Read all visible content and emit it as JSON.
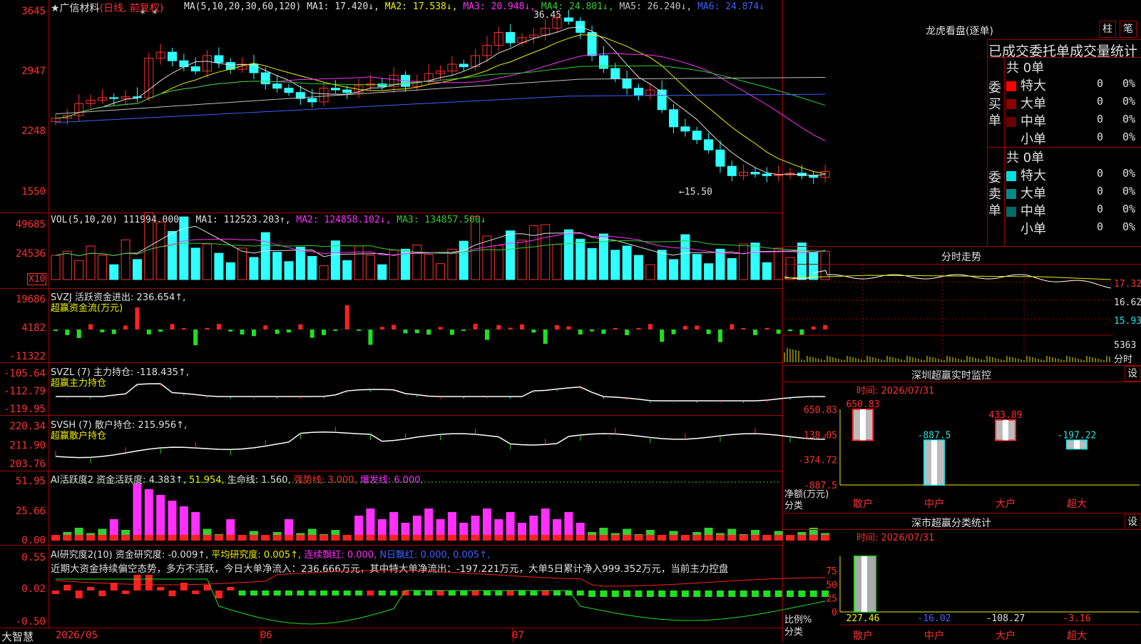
{
  "main": {
    "title": "★广信材料",
    "period": "(日线, 前复权)",
    "ma_prefix": "MA(5,10,20,30,60,120)",
    "ma": [
      {
        "label": "MA1: 17.420↓,",
        "color": "#e0e0e0"
      },
      {
        "label": "MA2: 17.538↓,",
        "color": "#f0f000"
      },
      {
        "label": "MA3: 20.948↓,",
        "color": "#ff30ff"
      },
      {
        "label": "MA4: 24.801↓,",
        "color": "#30d030"
      },
      {
        "label": "MA5: 26.240↓,",
        "color": "#c0c0c0"
      },
      {
        "label": "MA6: 24.874↓",
        "color": "#4060ff"
      }
    ],
    "y_ticks": [
      "3645",
      "2947",
      "2248",
      "1550"
    ],
    "high_label": "36.45",
    "low_label": "←15.50",
    "star_marks": "* *"
  },
  "vol": {
    "header": "VOL(5,10,20)",
    "value": "111994.000↑,",
    "ma": [
      {
        "label": "MA1: 112523.203↑,",
        "color": "#e0e0e0"
      },
      {
        "label": "MA2: 124858.102↓,",
        "color": "#ff30ff"
      },
      {
        "label": "MA3: 134857.500↓",
        "color": "#30d030"
      }
    ],
    "y_ticks": [
      "49685",
      "24536"
    ],
    "unit": "X10"
  },
  "svzj": {
    "header": "SVZJ  活跃资金进出: 236.654↑,",
    "sub": "超赢资金流(万元)",
    "y_ticks": [
      "19686",
      "4182",
      "-11322"
    ]
  },
  "svzl": {
    "header": "SVZL (7) 主力持仓: -118.435↑,",
    "sub": "超赢主力持仓",
    "y_ticks": [
      "-105.64",
      "-112.79",
      "-119.95"
    ]
  },
  "svsh": {
    "header": "SVSH (7) 散户持仓: 215.956↑,",
    "sub": "超赢散户持仓",
    "y_ticks": [
      "220.34",
      "211.90",
      "203.76"
    ]
  },
  "ai2": {
    "name": "AI活跃度2 资金活跃度: 4.383↑,",
    "v2": "51.954,",
    "v3": "生命线: 1.560,",
    "v4": "强势线: 3.000,",
    "v5": "爆发线: 6.000,",
    "y_ticks": [
      "51.95",
      "25.66",
      "0.00"
    ]
  },
  "ai_research": {
    "name": "AI研究度2(10) 资金研究度: -0.009↑,",
    "avg": "平均研究度: 0.005↑,",
    "red1": "连续飘红: 0.000,",
    "red2": "N日飘红: 0.000,",
    "v": "0.005↑,",
    "comment": "近期大资金持续偏空态势，多方不活跃，今日大单净流入：236.666万元，其中特大单净流出：-197.221万元，大单5日累计净入999.352万元，当前主力控盘",
    "y_ticks": [
      "0.55",
      "0.02",
      "-0.50"
    ]
  },
  "xaxis": {
    "brand": "大智慧",
    "dates": [
      "2026/05",
      "06",
      "07"
    ]
  },
  "dragon": {
    "title": "龙虎看盘(逐单)",
    "btn_bar": "柱",
    "btn_pen": "笔",
    "subtitle": "已成交委托单成交量统计",
    "buy_label": "委买单",
    "sell_label": "委卖单",
    "buy_total": "共 0单",
    "sell_total": "共 0单",
    "rows": [
      "特大",
      "大单",
      "中单",
      "小单"
    ],
    "buy_colors": [
      "#ff0000",
      "#8b0000",
      "#6a0000",
      ""
    ],
    "sell_colors": [
      "#00e0e0",
      "#008b8b",
      "#006a6a",
      ""
    ],
    "zero": "0",
    "pct": "0%"
  },
  "intraday": {
    "title": "分时走势",
    "y_ticks": [
      "17.32",
      "16.62",
      "15.93"
    ],
    "vol_label": "5363",
    "unit": "分时"
  },
  "monitor": {
    "title": "深圳超赢实时监控",
    "btn": "设",
    "time": "时间: 2026/07/31",
    "y_ticks": [
      "650.83",
      "138.05",
      "-374.72",
      "-887.5"
    ],
    "ylabel": "净额(万元)",
    "xlabel": "分类",
    "categories": [
      "散户",
      "中户",
      "大户",
      "超大"
    ],
    "values": [
      650.83,
      -887.5,
      433.89,
      -197.22
    ],
    "value_labels": [
      "650.83",
      "-887.5",
      "433.89",
      "-197.22"
    ]
  },
  "classify": {
    "title": "深市超赢分类统计",
    "btn": "设",
    "time": "时间: 2026/07/31",
    "y_ticks": [
      "75",
      "50",
      "25",
      "0"
    ],
    "ylabel": "比例%",
    "xlabel": "分类",
    "categories": [
      "散户",
      "中户",
      "大户",
      "超大"
    ],
    "value_labels": [
      "227.46",
      "-16.02",
      "-108.27",
      "-3.16"
    ],
    "value_colors": [
      "#f0f000",
      "#4060ff",
      "#e0e0e0",
      "#ff3030"
    ]
  }
}
